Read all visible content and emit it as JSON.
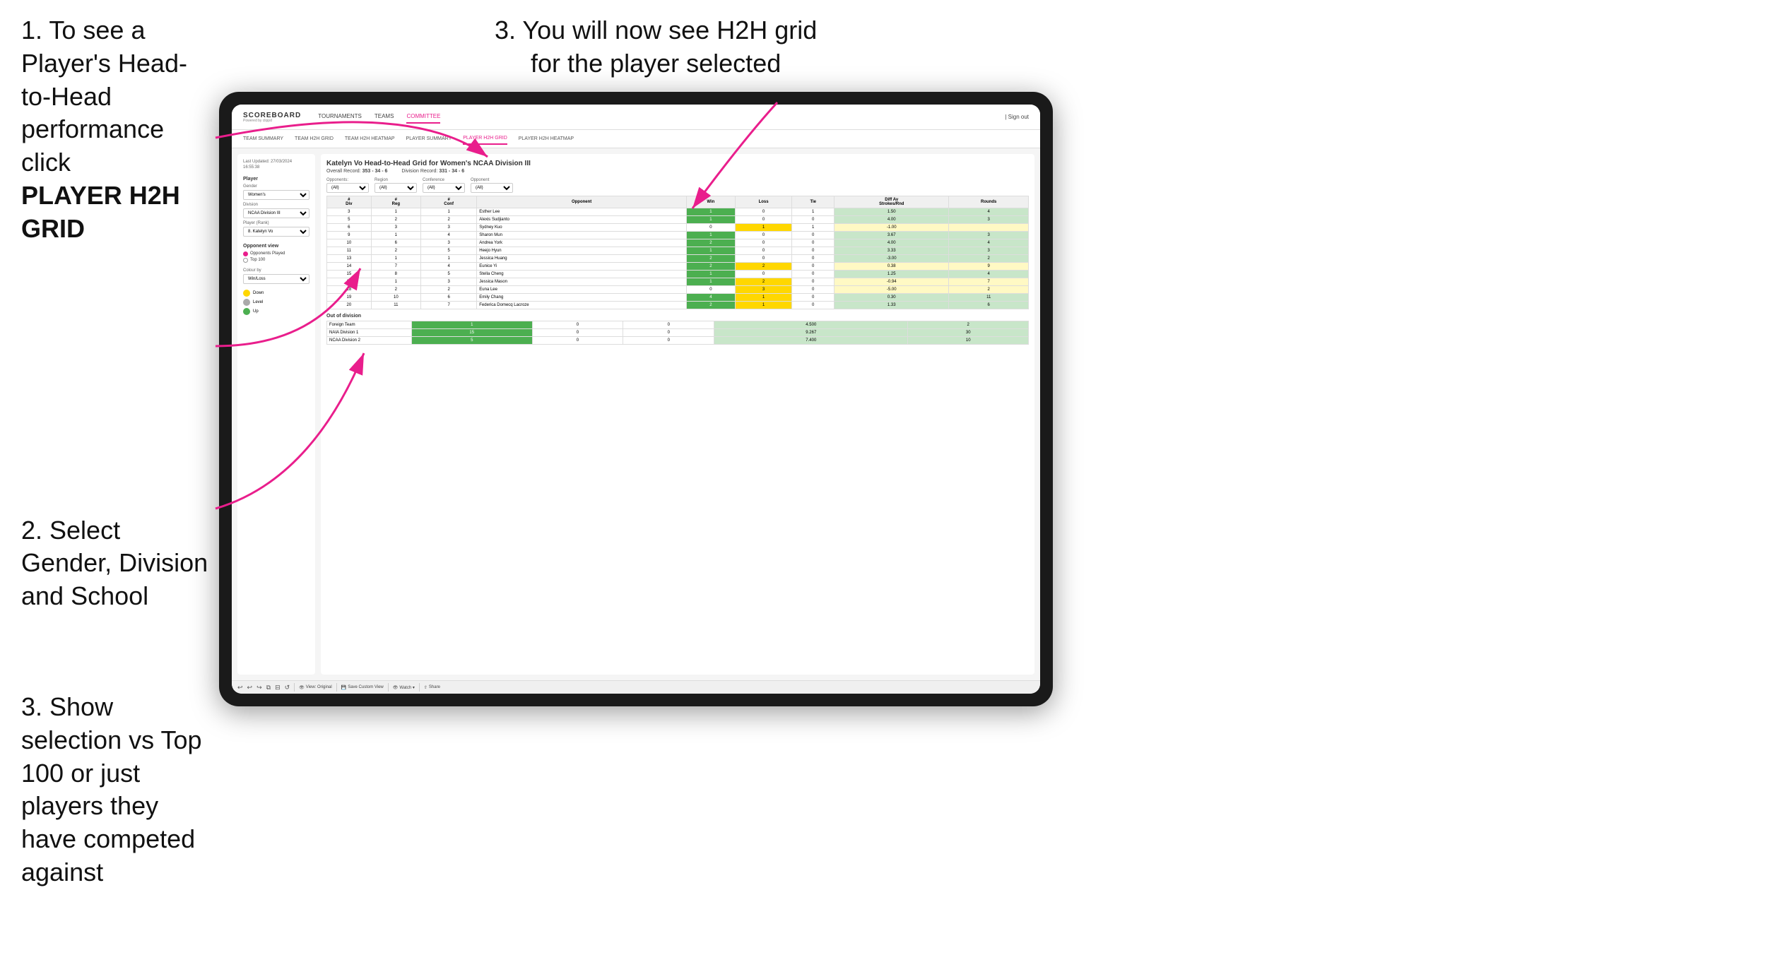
{
  "instructions": {
    "top_left_1": "1. To see a Player's Head-to-Head performance click",
    "top_left_1_bold": "PLAYER H2H GRID",
    "top_left_2": "2. Select Gender, Division and School",
    "bottom_left_3": "3. Show selection vs Top 100 or just players they have competed against",
    "top_right_3": "3. You will now see H2H grid for the player selected"
  },
  "nav": {
    "logo": "SCOREBOARD",
    "logo_sub": "Powered by clippd",
    "links": [
      "TOURNAMENTS",
      "TEAMS",
      "COMMITTEE"
    ],
    "active_link": "COMMITTEE",
    "right": "| Sign out"
  },
  "sub_nav": {
    "links": [
      "TEAM SUMMARY",
      "TEAM H2H GRID",
      "TEAM H2H HEATMAP",
      "PLAYER SUMMARY",
      "PLAYER H2H GRID",
      "PLAYER H2H HEATMAP"
    ],
    "active_link": "PLAYER H2H GRID"
  },
  "left_panel": {
    "timestamp": "Last Updated: 27/03/2024\n16:55:38",
    "player_section": "Player",
    "gender_label": "Gender",
    "gender_value": "Women's",
    "division_label": "Division",
    "division_value": "NCAA Division III",
    "player_rank_label": "Player (Rank)",
    "player_rank_value": "8. Katelyn Vo",
    "opponent_view_label": "Opponent view",
    "opponent_options": [
      "Opponents Played",
      "Top 100"
    ],
    "opponent_selected": "Opponents Played",
    "colour_by_label": "Colour by",
    "colour_by_value": "Win/Loss",
    "legend": [
      {
        "label": "Down",
        "color": "yellow"
      },
      {
        "label": "Level",
        "color": "gray"
      },
      {
        "label": "Up",
        "color": "green"
      }
    ]
  },
  "right_panel": {
    "title": "Katelyn Vo Head-to-Head Grid for Women's NCAA Division III",
    "overall_record_label": "Overall Record:",
    "overall_record": "353 - 34 - 6",
    "division_record_label": "Division Record:",
    "division_record": "331 - 34 - 6",
    "filters": {
      "opponents_label": "Opponents:",
      "opponents_value": "(All)",
      "region_label": "Region",
      "region_value": "(All)",
      "conference_label": "Conference",
      "conference_value": "(All)",
      "opponent_label": "Opponent",
      "opponent_value": "(All)"
    },
    "table_headers": [
      "#\nDiv",
      "#\nReg",
      "#\nConf",
      "Opponent",
      "Win",
      "Loss",
      "Tie",
      "Diff Av\nStrokes/Rnd",
      "Rounds"
    ],
    "rows": [
      {
        "div": 3,
        "reg": 1,
        "conf": 1,
        "opponent": "Esther Lee",
        "win": 1,
        "loss": 0,
        "tie": 1,
        "diff": "1.50",
        "rounds": 4,
        "win_color": "green"
      },
      {
        "div": 5,
        "reg": 2,
        "conf": 2,
        "opponent": "Alexis Sudjianto",
        "win": 1,
        "loss": 0,
        "tie": 0,
        "diff": "4.00",
        "rounds": 3,
        "win_color": "green"
      },
      {
        "div": 6,
        "reg": 3,
        "conf": 3,
        "opponent": "Sydney Kuo",
        "win": 0,
        "loss": 1,
        "tie": 1,
        "diff": "-1.00",
        "rounds": "",
        "win_color": "yellow"
      },
      {
        "div": 9,
        "reg": 1,
        "conf": 4,
        "opponent": "Sharon Mun",
        "win": 1,
        "loss": 0,
        "tie": 0,
        "diff": "3.67",
        "rounds": 3,
        "win_color": "green"
      },
      {
        "div": 10,
        "reg": 6,
        "conf": 3,
        "opponent": "Andrea York",
        "win": 2,
        "loss": 0,
        "tie": 0,
        "diff": "4.00",
        "rounds": 4,
        "win_color": "green"
      },
      {
        "div": 11,
        "reg": 2,
        "conf": 5,
        "opponent": "Heejo Hyun",
        "win": 1,
        "loss": 0,
        "tie": 0,
        "diff": "3.33",
        "rounds": 3,
        "win_color": "green"
      },
      {
        "div": 13,
        "reg": 1,
        "conf": 1,
        "opponent": "Jessica Huang",
        "win": 2,
        "loss": 0,
        "tie": 0,
        "diff": "-3.00",
        "rounds": 2,
        "win_color": "green"
      },
      {
        "div": 14,
        "reg": 7,
        "conf": 4,
        "opponent": "Eunice Yi",
        "win": 2,
        "loss": 2,
        "tie": 0,
        "diff": "0.38",
        "rounds": 9,
        "win_color": "yellow"
      },
      {
        "div": 15,
        "reg": 8,
        "conf": 5,
        "opponent": "Stella Cheng",
        "win": 1,
        "loss": 0,
        "tie": 0,
        "diff": "1.25",
        "rounds": 4,
        "win_color": "green"
      },
      {
        "div": 16,
        "reg": 1,
        "conf": 3,
        "opponent": "Jessica Mason",
        "win": 1,
        "loss": 2,
        "tie": 0,
        "diff": "-0.94",
        "rounds": 7,
        "win_color": "yellow"
      },
      {
        "div": 18,
        "reg": 2,
        "conf": 2,
        "opponent": "Euna Lee",
        "win": 0,
        "loss": 3,
        "tie": 0,
        "diff": "-5.00",
        "rounds": 2,
        "win_color": "yellow"
      },
      {
        "div": 19,
        "reg": 10,
        "conf": 6,
        "opponent": "Emily Chang",
        "win": 4,
        "loss": 1,
        "tie": 0,
        "diff": "0.30",
        "rounds": 11,
        "win_color": "green"
      },
      {
        "div": 20,
        "reg": 11,
        "conf": 7,
        "opponent": "Federica Domecq Lacroze",
        "win": 2,
        "loss": 1,
        "tie": 0,
        "diff": "1.33",
        "rounds": 6,
        "win_color": "green"
      }
    ],
    "out_of_division_title": "Out of division",
    "out_of_division_rows": [
      {
        "opponent": "Foreign Team",
        "win": 1,
        "loss": 0,
        "tie": 0,
        "diff": "4.500",
        "rounds": 2
      },
      {
        "opponent": "NAIA Division 1",
        "win": 15,
        "loss": 0,
        "tie": 0,
        "diff": "9.267",
        "rounds": 30
      },
      {
        "opponent": "NCAA Division 2",
        "win": 5,
        "loss": 0,
        "tie": 0,
        "diff": "7.400",
        "rounds": 10
      }
    ]
  },
  "toolbar": {
    "buttons": [
      "View: Original",
      "Save Custom View",
      "Watch",
      "Share"
    ]
  }
}
